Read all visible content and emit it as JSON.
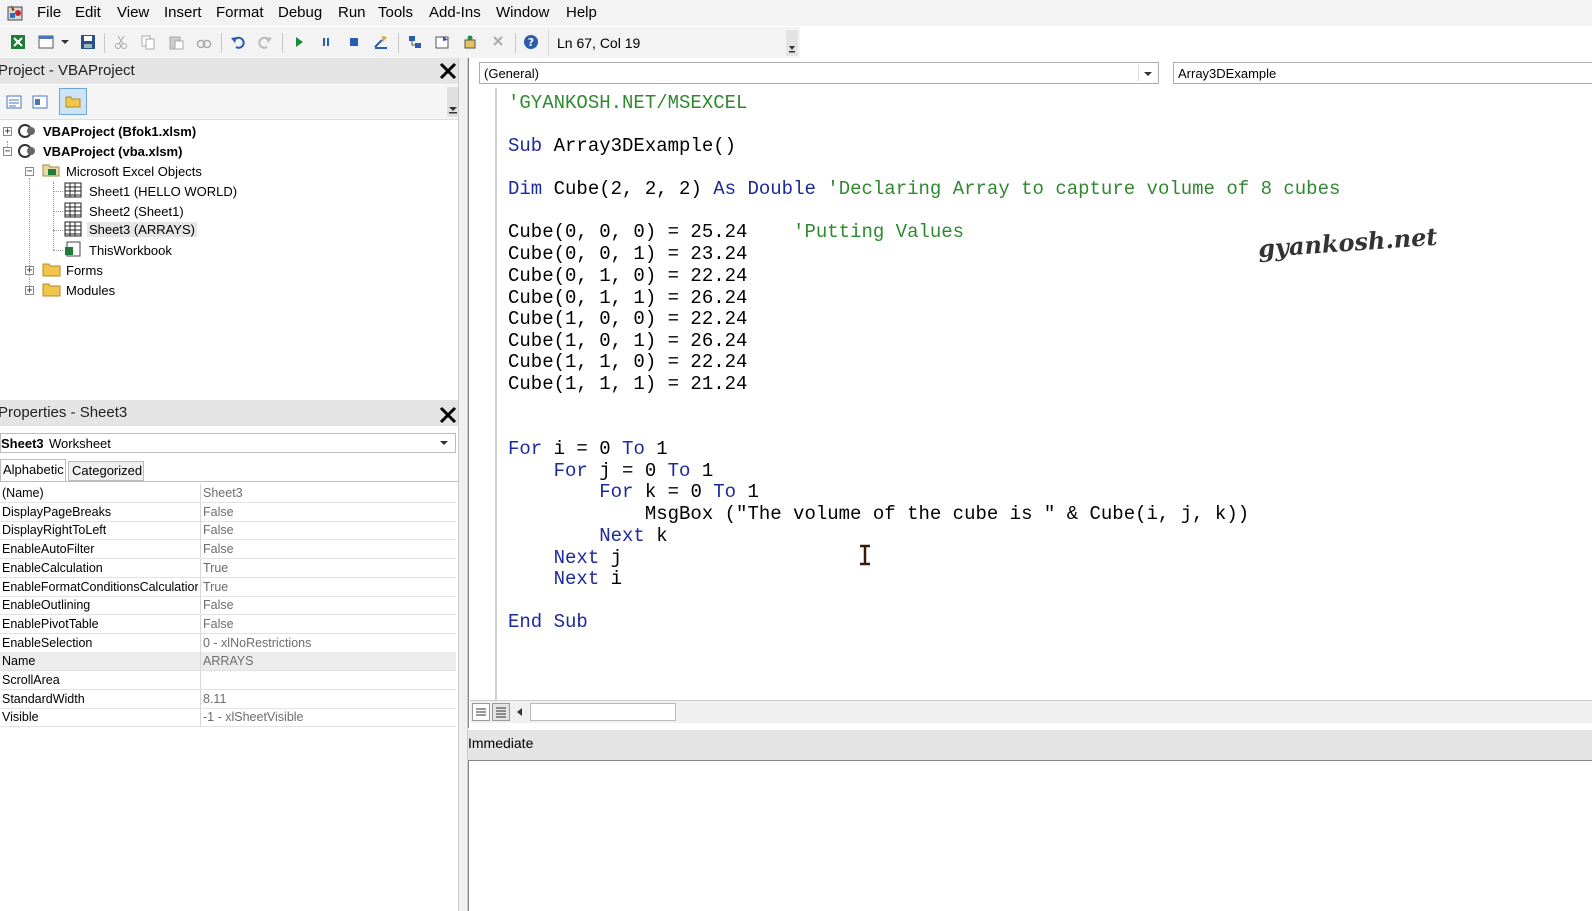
{
  "menu": [
    "File",
    "Edit",
    "View",
    "Insert",
    "Format",
    "Debug",
    "Run",
    "Tools",
    "Add-Ins",
    "Window",
    "Help"
  ],
  "toolbar": {
    "position": "Ln 67, Col 19"
  },
  "project": {
    "title": "Project - VBAProject",
    "tree": [
      {
        "label": "VBAProject (Bfok1.xlsm)",
        "bold": true
      },
      {
        "label": "VBAProject (vba.xlsm)",
        "bold": true
      },
      {
        "label": "Microsoft Excel Objects"
      },
      {
        "label": "Sheet1 (HELLO WORLD)"
      },
      {
        "label": "Sheet2 (Sheet1)"
      },
      {
        "label": "Sheet3 (ARRAYS)"
      },
      {
        "label": "ThisWorkbook"
      },
      {
        "label": "Forms"
      },
      {
        "label": "Modules"
      }
    ]
  },
  "properties": {
    "title": "Properties - Sheet3",
    "object_name": "Sheet3",
    "object_type": "Worksheet",
    "tabs": [
      "Alphabetic",
      "Categorized"
    ],
    "rows": [
      {
        "name": "(Name)",
        "value": "Sheet3"
      },
      {
        "name": "DisplayPageBreaks",
        "value": "False"
      },
      {
        "name": "DisplayRightToLeft",
        "value": "False"
      },
      {
        "name": "EnableAutoFilter",
        "value": "False"
      },
      {
        "name": "EnableCalculation",
        "value": "True"
      },
      {
        "name": "EnableFormatConditionsCalculation",
        "value": "True"
      },
      {
        "name": "EnableOutlining",
        "value": "False"
      },
      {
        "name": "EnablePivotTable",
        "value": "False"
      },
      {
        "name": "EnableSelection",
        "value": "0 - xlNoRestrictions"
      },
      {
        "name": "Name",
        "value": "ARRAYS"
      },
      {
        "name": "ScrollArea",
        "value": ""
      },
      {
        "name": "StandardWidth",
        "value": "8.11"
      },
      {
        "name": "Visible",
        "value": "-1 - xlSheetVisible"
      }
    ]
  },
  "code_window": {
    "object_dropdown": "(General)",
    "procedure_dropdown": "Array3DExample",
    "lines": [
      [
        {
          "t": "'GYANKOSH.NET/MSEXCEL",
          "c": "cm"
        }
      ],
      [
        {
          "t": "Sub",
          "c": "kw"
        },
        {
          "t": " Array3DExample()",
          "c": ""
        }
      ],
      [
        {
          "t": "Dim",
          "c": "kw"
        },
        {
          "t": " Cube(2, 2, 2) ",
          "c": ""
        },
        {
          "t": "As",
          "c": "kw"
        },
        {
          "t": " ",
          "c": ""
        },
        {
          "t": "Double",
          "c": "kw"
        },
        {
          "t": " 'Declaring Array to capture volume of 8 cubes",
          "c": "cm"
        }
      ],
      [
        {
          "t": "Cube(0, 0, 0) = 25.24    ",
          "c": ""
        },
        {
          "t": "'Putting Values",
          "c": "cm"
        }
      ],
      [
        {
          "t": "Cube(0, 0, 1) = 23.24",
          "c": ""
        }
      ],
      [
        {
          "t": "Cube(0, 1, 0) = 22.24",
          "c": ""
        }
      ],
      [
        {
          "t": "Cube(0, 1, 1) = 26.24",
          "c": ""
        }
      ],
      [
        {
          "t": "Cube(1, 0, 0) = 22.24",
          "c": ""
        }
      ],
      [
        {
          "t": "Cube(1, 0, 1) = 26.24",
          "c": ""
        }
      ],
      [
        {
          "t": "Cube(1, 1, 0) = 22.24",
          "c": ""
        }
      ],
      [
        {
          "t": "Cube(1, 1, 1) = 21.24",
          "c": ""
        }
      ],
      [
        {
          "t": "For",
          "c": "kw"
        },
        {
          "t": " i = 0 ",
          "c": ""
        },
        {
          "t": "To",
          "c": "kw"
        },
        {
          "t": " 1",
          "c": ""
        }
      ],
      [
        {
          "t": "    ",
          "c": ""
        },
        {
          "t": "For",
          "c": "kw"
        },
        {
          "t": " j = 0 ",
          "c": ""
        },
        {
          "t": "To",
          "c": "kw"
        },
        {
          "t": " 1",
          "c": ""
        }
      ],
      [
        {
          "t": "        ",
          "c": ""
        },
        {
          "t": "For",
          "c": "kw"
        },
        {
          "t": " k = 0 ",
          "c": ""
        },
        {
          "t": "To",
          "c": "kw"
        },
        {
          "t": " 1",
          "c": ""
        }
      ],
      [
        {
          "t": "            MsgBox (\"The volume of the cube is \" & Cube(i, j, k))",
          "c": ""
        }
      ],
      [
        {
          "t": "        ",
          "c": ""
        },
        {
          "t": "Next",
          "c": "kw"
        },
        {
          "t": " k",
          "c": ""
        }
      ],
      [
        {
          "t": "    ",
          "c": ""
        },
        {
          "t": "Next",
          "c": "kw"
        },
        {
          "t": " j",
          "c": ""
        }
      ],
      [
        {
          "t": "    ",
          "c": ""
        },
        {
          "t": "Next",
          "c": "kw"
        },
        {
          "t": " i",
          "c": ""
        }
      ],
      [
        {
          "t": "End Sub",
          "c": "kw"
        }
      ]
    ],
    "watermark": "gyankosh.net"
  },
  "immediate": {
    "title": "Immediate"
  },
  "colors": {
    "keyword": "#1c2a9b",
    "comment": "#2f8a2f",
    "pane_title_bg": "#e4e4e4"
  }
}
